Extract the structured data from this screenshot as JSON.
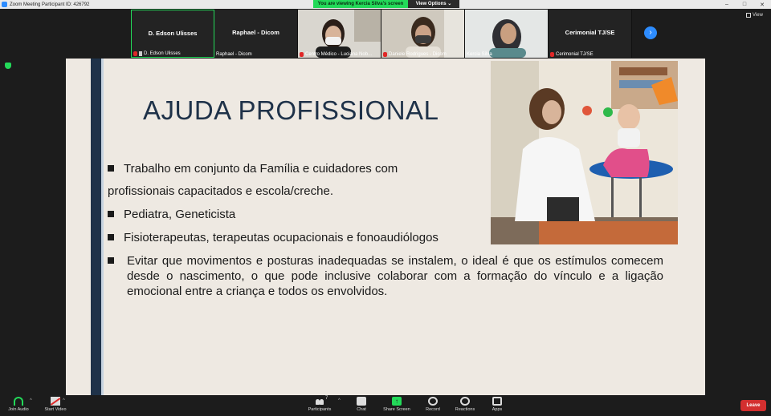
{
  "window": {
    "title": "Zoom Meeting Participant ID: 426792",
    "viewing_banner": "You are viewing Kercia Silva's screen",
    "view_options": "View Options",
    "view_toggle": "View"
  },
  "participants": [
    {
      "name": "D. Edson Ulisses",
      "label": "D. Edson Ulisses",
      "has_video": false,
      "muted": true,
      "pinned": true,
      "active": true
    },
    {
      "name": "Raphael - Dicom",
      "label": "Raphael - Dicom",
      "has_video": false,
      "muted": false,
      "pinned": false,
      "active": false
    },
    {
      "name": "",
      "label": "Centro Médico - Luciana Nob...",
      "has_video": true,
      "muted": true,
      "pinned": false,
      "active": false
    },
    {
      "name": "",
      "label": "Daniele Rodrigues - Dicom",
      "has_video": true,
      "muted": true,
      "pinned": false,
      "active": false
    },
    {
      "name": "",
      "label": "Kercia Silva",
      "has_video": true,
      "muted": false,
      "pinned": false,
      "active": false
    },
    {
      "name": "Cerimonial TJ/SE",
      "label": "Cerimonial TJ/SE",
      "has_video": false,
      "muted": true,
      "pinned": false,
      "active": false
    }
  ],
  "slide": {
    "title": "AJUDA PROFISSIONAL",
    "bullets": [
      "Trabalho em conjunto da Família e cuidadores com",
      "profissionais capacitados e escola/creche.",
      "Pediatra, Geneticista",
      "Fisioterapeutas, terapeutas ocupacionais e fonoaudiólogos",
      "Evitar que movimentos e posturas inadequadas se instalem, o ideal é que os estímulos comecem desde o nascimento, o que pode inclusive colaborar com a formação do vínculo e a ligação emocional entre a criança e todos os envolvidos."
    ]
  },
  "toolbar": {
    "join_audio": "Join Audio",
    "start_video": "Start Video",
    "participants": "Participants",
    "participants_count": "7",
    "chat": "Chat",
    "share_screen": "Share Screen",
    "record": "Record",
    "reactions": "Reactions",
    "apps": "Apps",
    "leave": "Leave"
  },
  "colors": {
    "accent_green": "#23d959",
    "zoom_blue": "#2d8cff",
    "leave_red": "#d32f2f",
    "slide_navy": "#1f3249",
    "slide_bg": "#eee9e2"
  }
}
